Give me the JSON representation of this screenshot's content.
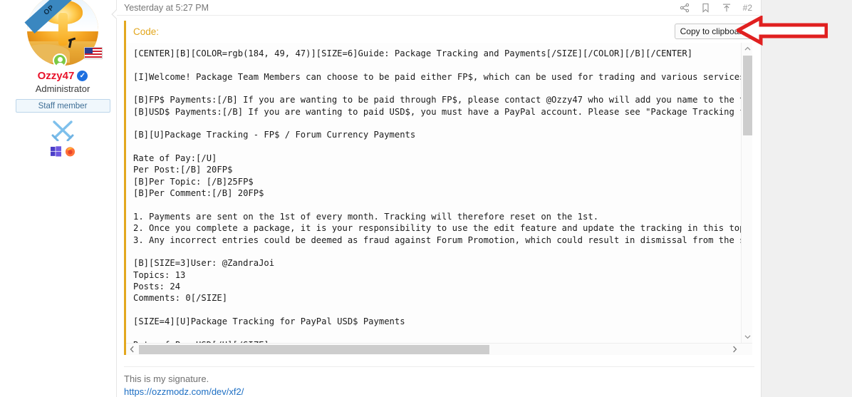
{
  "user": {
    "name": "Ozzy47",
    "title": "Administrator",
    "staff_badge": "Staff member",
    "avatar_ribbon": "OP",
    "icons": {
      "verified": "verified-badge-icon",
      "online": "online-status-icon",
      "flag": "us-flag-icon",
      "swords": "crossed-swords-icon",
      "windows": "windows-os-icon",
      "firefox": "firefox-browser-icon"
    }
  },
  "post": {
    "date": "Yesterday at 5:27 PM",
    "number": "#2",
    "actions": {
      "share": "share-icon",
      "bookmark": "bookmark-icon",
      "quote_jump": "arrow-up-icon"
    }
  },
  "code_block": {
    "title": "Code:",
    "copy_label": "Copy to clipboard",
    "accent_color": "#e3a81f",
    "content": "[CENTER][B][COLOR=rgb(184, 49, 47)][SIZE=6]Guide: Package Tracking and Payments[/SIZE][/COLOR][/B][/CENTER]\n\n[I]Welcome! Package Team Members can choose to be paid either FP$, which can be used for trading and various services on Fo\n\n[B]FP$ Payments:[/B] If you are wanting to be paid through FP$, please contact @Ozzy47 who will add you name to the tracki\n[B]USD$ Payments:[/B] If you are wanting to paid USD$, you must have a PayPal account. Please see \"Package Tracking for Pay\n\n[B][U]Package Tracking - FP$ / Forum Currency Payments\n\nRate of Pay:[/U]\nPer Post:[/B] 20FP$\n[B]Per Topic: [/B]25FP$\n[B]Per Comment:[/B] 20FP$\n\n1. Payments are sent on the 1st of every month. Tracking will therefore reset on the 1st.\n2. Once you complete a package, it is your responsibility to use the edit feature and update the tracking in this topic ac\n3. Any incorrect entries could be deemed as fraud against Forum Promotion, which could result in dismissal from the staffi\n\n[B][SIZE=3]User: @ZandraJoi\nTopics: 13\nPosts: 24\nComments: 0[/SIZE]\n\n[SIZE=4][U]Package Tracking for PayPal USD$ Payments\n\nRate of Pay USD[/U][/SIZE]"
  },
  "signature": {
    "text": "This is my signature.",
    "link": "https://ozzmodz.com/dev/xf2/",
    "link_color": "#1d6fc4"
  },
  "annotation": {
    "arrow": "red-left-arrow",
    "color": "#e02020"
  },
  "scrollbars": {
    "vertical": {
      "up": "chevron-up-icon",
      "down": "chevron-down-icon"
    },
    "horizontal": {
      "left": "chevron-left-icon",
      "right": "chevron-right-icon"
    }
  }
}
